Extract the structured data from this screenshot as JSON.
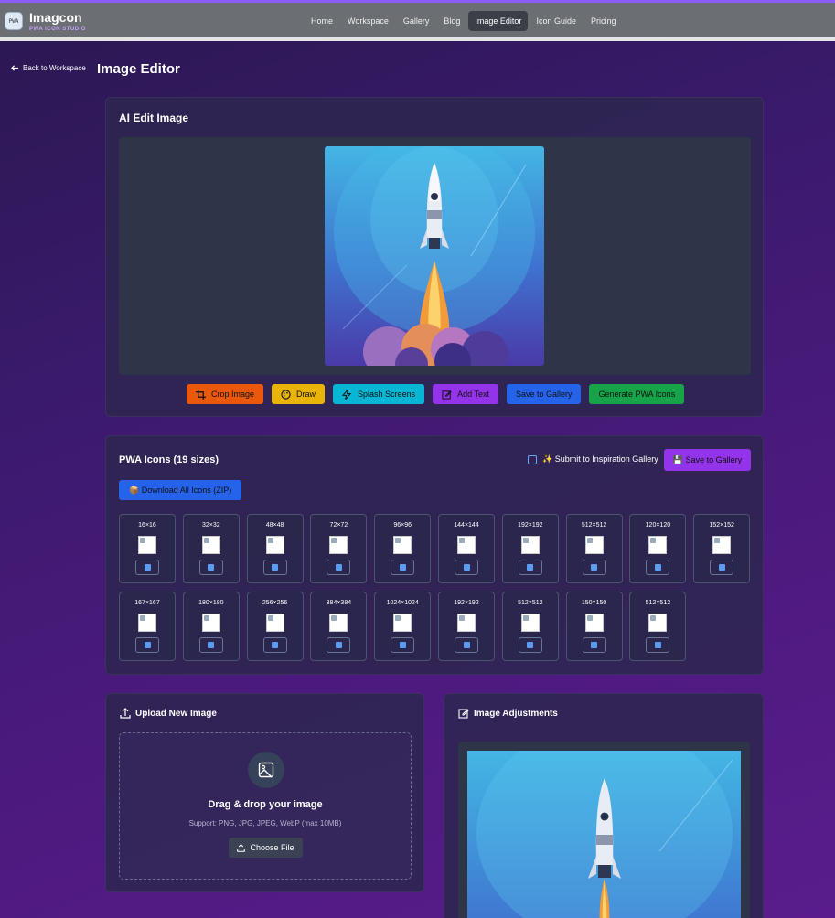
{
  "brand": {
    "name": "Imagcon",
    "tagline": "PWA ICON STUDIO",
    "logo_text": "PWA"
  },
  "nav": {
    "items": [
      {
        "label": "Home"
      },
      {
        "label": "Workspace"
      },
      {
        "label": "Gallery"
      },
      {
        "label": "Blog"
      },
      {
        "label": "Image Editor",
        "active": true
      },
      {
        "label": "Icon Guide"
      },
      {
        "label": "Pricing"
      }
    ]
  },
  "header": {
    "back_label": "Back to Workspace",
    "page_title": "Image Editor"
  },
  "editor": {
    "title": "AI Edit Image",
    "image_icon": "rocket-launch-illustration",
    "tools": [
      {
        "label": "Crop Image",
        "icon": "crop-icon",
        "color": "#ea580c"
      },
      {
        "label": "Draw",
        "icon": "palette-icon",
        "color": "#eab308"
      },
      {
        "label": "Splash Screens",
        "icon": "zap-icon",
        "color": "#06b6d4"
      },
      {
        "label": "Add Text",
        "icon": "edit-icon",
        "color": "#9333ea"
      },
      {
        "label": "Save to Gallery",
        "icon": "",
        "color": "#2563eb"
      },
      {
        "label": "Generate PWA Icons",
        "icon": "",
        "color": "#16a34a"
      }
    ]
  },
  "pwa": {
    "title": "PWA Icons (19 sizes)",
    "submit_label": "✨ Submit to Inspiration Gallery",
    "save_label": "💾 Save to Gallery",
    "download_all_label": "📦 Download All Icons (ZIP)",
    "sizes": [
      "16×16",
      "32×32",
      "48×48",
      "72×72",
      "96×96",
      "144×144",
      "192×192",
      "512×512",
      "120×120",
      "152×152",
      "167×167",
      "180×180",
      "256×256",
      "384×384",
      "1024×1024",
      "192×192",
      "512×512",
      "150×150",
      "512×512"
    ]
  },
  "upload": {
    "title": "Upload New Image",
    "drop_title": "Drag & drop your image",
    "drop_sub": "Support: PNG, JPG, JPEG, WebP (max 10MB)",
    "choose_label": "Choose File"
  },
  "adjust": {
    "title": "Image Adjustments"
  },
  "colors": {
    "accent": "#8b5cf6",
    "nav_active": "#3a3f48",
    "card": "#2d2550"
  }
}
